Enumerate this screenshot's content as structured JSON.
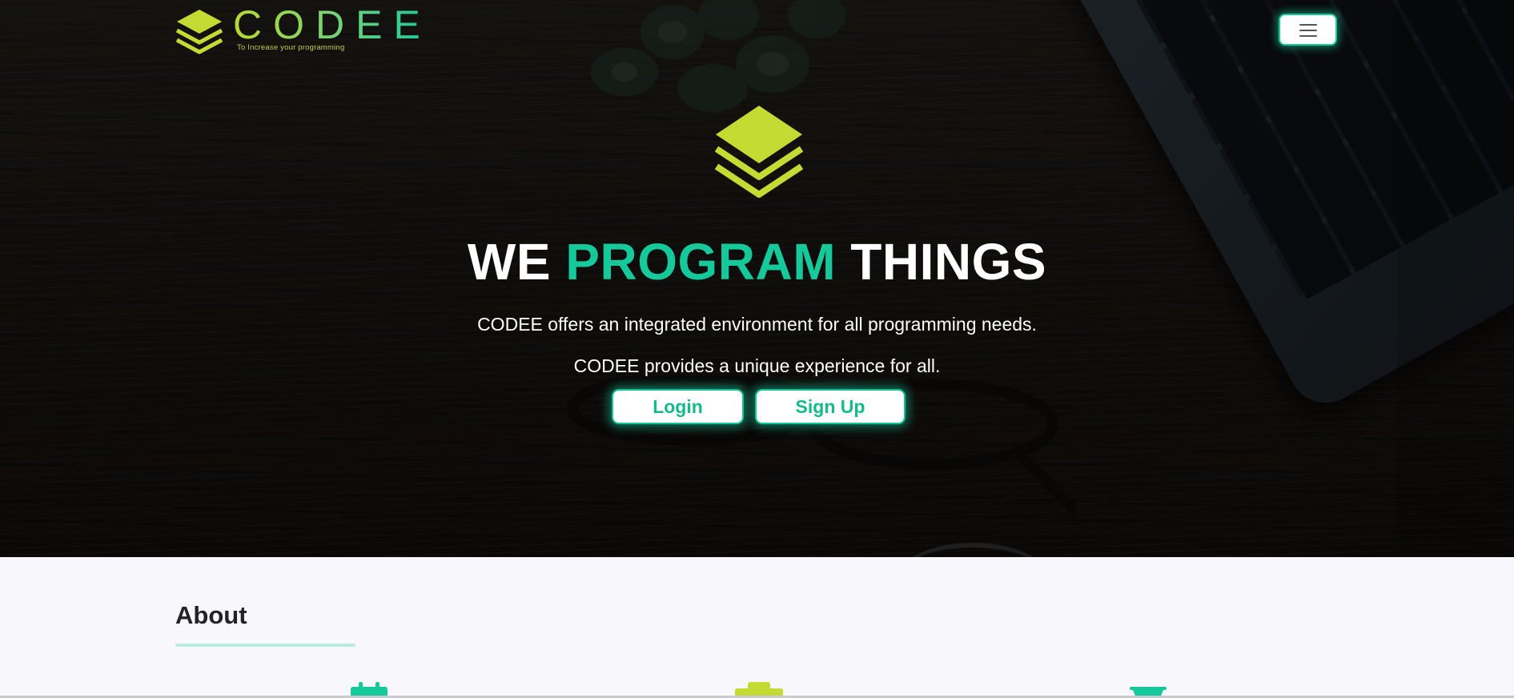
{
  "brand": {
    "name": "CODEE",
    "tagline": "To Increase your programming",
    "colors": {
      "lime": "#c4db34",
      "teal": "#16c99b"
    }
  },
  "nav": {
    "menu_icon": "hamburger-icon"
  },
  "hero": {
    "logo_icon": "layers-stack-icon",
    "title_part1": "WE",
    "title_accent": "PROGRAM",
    "title_part2": "THINGS",
    "line1": "CODEE offers an integrated environment for all programming needs.",
    "line2": "CODEE provides a unique experience for all.",
    "login_label": "Login",
    "signup_label": "Sign Up",
    "accent_color": "#16c99b"
  },
  "about": {
    "title": "About",
    "feature_icons": [
      "calendar-icon",
      "briefcase-icon",
      "basket-icon"
    ]
  }
}
